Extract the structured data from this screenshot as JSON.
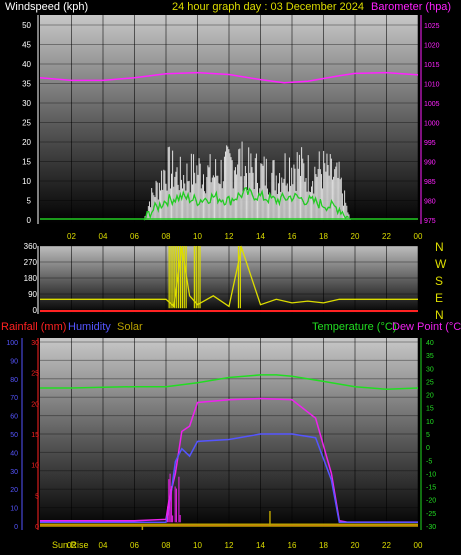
{
  "header": {
    "wind_label": "Windspeed (kph)",
    "title": "24 hour graph day : 03 December 2024",
    "baro_label": "Barometer (hpa)"
  },
  "compass": [
    "N",
    "W",
    "S",
    "E",
    "N"
  ],
  "lower_header": {
    "rain_label": "Rainfall (mm)",
    "humidity_label": "Humidity",
    "solar_label": "Solar",
    "temp_label": "Temperature (°C)",
    "dew_label": "Dew Point (°C)"
  },
  "sun_rise_label": "Sun Rise",
  "colors": {
    "wind": "#ffffff",
    "wind_avg": "#22cc22",
    "barometer": "#ff22ff",
    "direction": "#dddd00",
    "rain": "#ff2222",
    "humidity": "#5555ff",
    "solar": "#b8a000",
    "temperature": "#22dd22",
    "dew_point": "#ee22ee",
    "yellow_labels": "#dddd00"
  },
  "x_ticks": [
    "02",
    "04",
    "06",
    "08",
    "10",
    "12",
    "14",
    "16",
    "18",
    "20",
    "22",
    "00"
  ],
  "chart_data": [
    {
      "type": "line",
      "title": "24 hour graph day : 03 December 2024",
      "ylabel": "Windspeed (kph)",
      "ylim": [
        0,
        50
      ],
      "y_ticks": [
        0,
        5,
        10,
        15,
        20,
        25,
        30,
        35,
        40,
        45,
        50
      ],
      "y2label": "Barometer (hpa)",
      "y2lim": [
        975,
        1025
      ],
      "y2_ticks": [
        975,
        980,
        985,
        990,
        995,
        1000,
        1005,
        1010,
        1015,
        1020,
        1025
      ],
      "series": [
        {
          "name": "Barometer (hpa)",
          "axis": "right",
          "x": [
            0,
            2,
            4,
            6,
            8,
            10,
            12,
            14,
            15.5,
            17,
            19,
            20,
            22,
            24
          ],
          "y": [
            1011.5,
            1010.8,
            1010.8,
            1011.5,
            1012.5,
            1012.8,
            1012.3,
            1011.0,
            1010.2,
            1010.6,
            1012.0,
            1012.6,
            1012.8,
            1012.2
          ]
        }
      ],
      "wind_gust_envelope": {
        "x": [
          6.6,
          7,
          7.5,
          8,
          9,
          10,
          11,
          12,
          12.5,
          13,
          14,
          15,
          16,
          17,
          18,
          19,
          19.7
        ],
        "y": [
          0,
          8,
          13,
          20,
          16,
          19,
          17,
          20,
          24,
          19,
          18,
          17,
          22,
          18,
          19,
          15,
          0
        ]
      },
      "wind_average": {
        "x": [
          6.6,
          7,
          8,
          9,
          10,
          11,
          12,
          13,
          14,
          15,
          16,
          17,
          18,
          19,
          19.7
        ],
        "y": [
          0,
          2,
          5,
          6,
          5,
          6,
          5,
          7,
          6,
          5,
          6,
          5,
          4,
          3,
          0
        ]
      }
    },
    {
      "type": "scatter",
      "ylabel": "Wind direction",
      "ylim": [
        0,
        360
      ],
      "y_ticks": [
        0,
        90,
        180,
        270,
        360
      ],
      "y_tick_labels": [
        "0",
        "90",
        "180",
        "270",
        "360"
      ],
      "series": [
        {
          "name": "Wind direction",
          "x": [
            0,
            8,
            8.5,
            9,
            9.5,
            10,
            11,
            12,
            12.8,
            14,
            15,
            16,
            17,
            18,
            19,
            20,
            24
          ],
          "y": [
            60,
            60,
            20,
            350,
            80,
            30,
            80,
            20,
            350,
            30,
            60,
            40,
            50,
            40,
            60,
            60,
            60
          ]
        }
      ]
    },
    {
      "type": "line",
      "ylabel": "Humidity",
      "ylim": [
        0,
        100
      ],
      "y_ticks": [
        0,
        10,
        20,
        30,
        40,
        50,
        60,
        70,
        80,
        90,
        100
      ],
      "rain_ylim": [
        0,
        30
      ],
      "rain_ticks": [
        0,
        5,
        10,
        15,
        20,
        25,
        30
      ],
      "temp_ylim": [
        -30,
        40
      ],
      "temp_ticks": [
        -30,
        -25,
        -20,
        -15,
        -10,
        -5,
        0,
        5,
        10,
        15,
        20,
        25,
        30,
        35,
        40
      ],
      "series": [
        {
          "name": "Temperature (°C)",
          "axis": "temp",
          "x": [
            0,
            2,
            4,
            6,
            8,
            10,
            12,
            14,
            15,
            16,
            18,
            20,
            22,
            24
          ],
          "y": [
            22.5,
            22.5,
            22.8,
            23.0,
            23.0,
            24.5,
            26.5,
            27.5,
            27.5,
            27.0,
            25.0,
            23.0,
            22.0,
            22.5
          ]
        },
        {
          "name": "Dew Point (°C)",
          "axis": "temp",
          "x": [
            0,
            6,
            8,
            8.2,
            8.6,
            9.0,
            9.5,
            10,
            12,
            14,
            16,
            17.5,
            18.5,
            19,
            19.5,
            24
          ],
          "y": [
            -28,
            -28,
            -27.5,
            -20,
            -10,
            6,
            8,
            17,
            18,
            18.5,
            18,
            11,
            -10,
            -28,
            -28.5,
            -28.5
          ]
        },
        {
          "name": "Humidity",
          "axis": "left",
          "x": [
            0,
            6,
            8,
            8.2,
            8.6,
            9.0,
            9.5,
            10,
            12,
            14,
            16,
            17.5,
            18.5,
            19,
            19.5,
            24
          ],
          "y": [
            2,
            2,
            2,
            10,
            35,
            42,
            38,
            46,
            47,
            50,
            50,
            48,
            25,
            2,
            2,
            2
          ]
        },
        {
          "name": "Rainfall (mm)",
          "axis": "rain",
          "x": [
            0,
            24
          ],
          "y": [
            0.2,
            0.2
          ]
        },
        {
          "name": "Solar",
          "x": [
            0,
            6,
            12,
            18,
            24
          ],
          "y": [
            1,
            1,
            1,
            1,
            1
          ]
        }
      ]
    }
  ]
}
